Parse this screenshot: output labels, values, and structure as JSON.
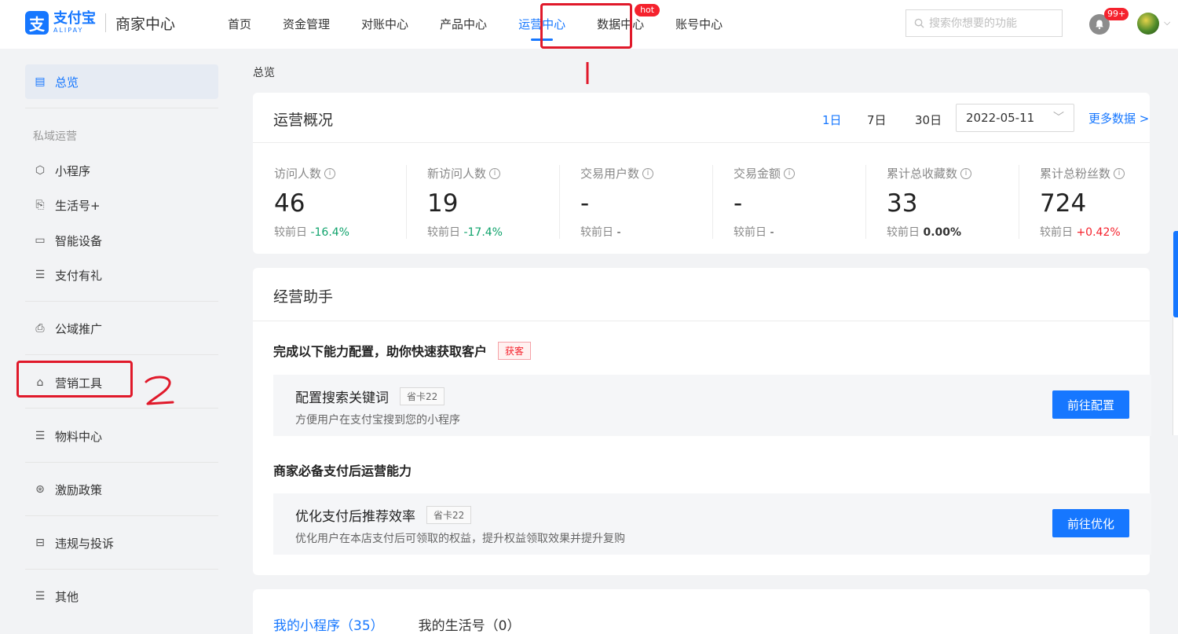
{
  "header": {
    "logo_cn": "支付宝",
    "logo_en": "ALIPAY",
    "title": "商家中心",
    "nav": [
      {
        "label": "首页"
      },
      {
        "label": "资金管理"
      },
      {
        "label": "对账中心"
      },
      {
        "label": "产品中心"
      },
      {
        "label": "运营中心",
        "active": true
      },
      {
        "label": "数据中心",
        "badge": "hot"
      },
      {
        "label": "账号中心"
      }
    ],
    "search_placeholder": "搜索你想要的功能",
    "notification_badge": "99+"
  },
  "annotations": {
    "mark_1": "1",
    "mark_2": "2",
    "color": "#e0192a"
  },
  "sidebar": {
    "overview": "总览",
    "group_private": "私域运营",
    "items": {
      "mini_program": "小程序",
      "life_account": "生活号+",
      "smart_device": "智能设备",
      "pay_gift": "支付有礼",
      "public_promo": "公域推广",
      "marketing_tools": "营销工具",
      "materials": "物料中心",
      "incentive": "激励政策",
      "violation": "违规与投诉",
      "other": "其他"
    }
  },
  "breadcrumb": "总览",
  "overview": {
    "title": "运营概况",
    "ranges": [
      "1日",
      "7日",
      "30日"
    ],
    "active_range": "1日",
    "date": "2022-05-11",
    "more": "更多数据 >",
    "compare_prefix": "较前日",
    "metrics": [
      {
        "label": "访问人数",
        "value": "46",
        "change": "-16.4%",
        "trend": "down"
      },
      {
        "label": "新访问人数",
        "value": "19",
        "change": "-17.4%",
        "trend": "down"
      },
      {
        "label": "交易用户数",
        "value": "-",
        "change": "-",
        "trend": "none"
      },
      {
        "label": "交易金额",
        "value": "-",
        "change": "-",
        "trend": "none"
      },
      {
        "label": "累计总收藏数",
        "value": "33",
        "change": "0.00%",
        "trend": "flat"
      },
      {
        "label": "累计总粉丝数",
        "value": "724",
        "change": "+0.42%",
        "trend": "up"
      }
    ]
  },
  "assistant": {
    "title": "经营助手",
    "section1": {
      "heading": "完成以下能力配置，助你快速获取客户",
      "tag": "获客"
    },
    "task1": {
      "title": "配置搜索关键词",
      "tag": "省卡22",
      "desc": "方便用户在支付宝搜到您的小程序",
      "button": "前往配置"
    },
    "section2": {
      "heading": "商家必备支付后运营能力"
    },
    "task2": {
      "title": "优化支付后推荐效率",
      "tag": "省卡22",
      "desc": "优化用户在本店支付后可领取的权益，提升权益领取效果并提升复购",
      "button": "前往优化"
    }
  },
  "bottom_tabs": [
    {
      "label": "我的小程序（35）",
      "active": true
    },
    {
      "label": "我的生活号（0）",
      "active": false
    }
  ],
  "colors": {
    "accent": "#1677ff",
    "down": "#10a36c",
    "up": "#f5222d"
  }
}
